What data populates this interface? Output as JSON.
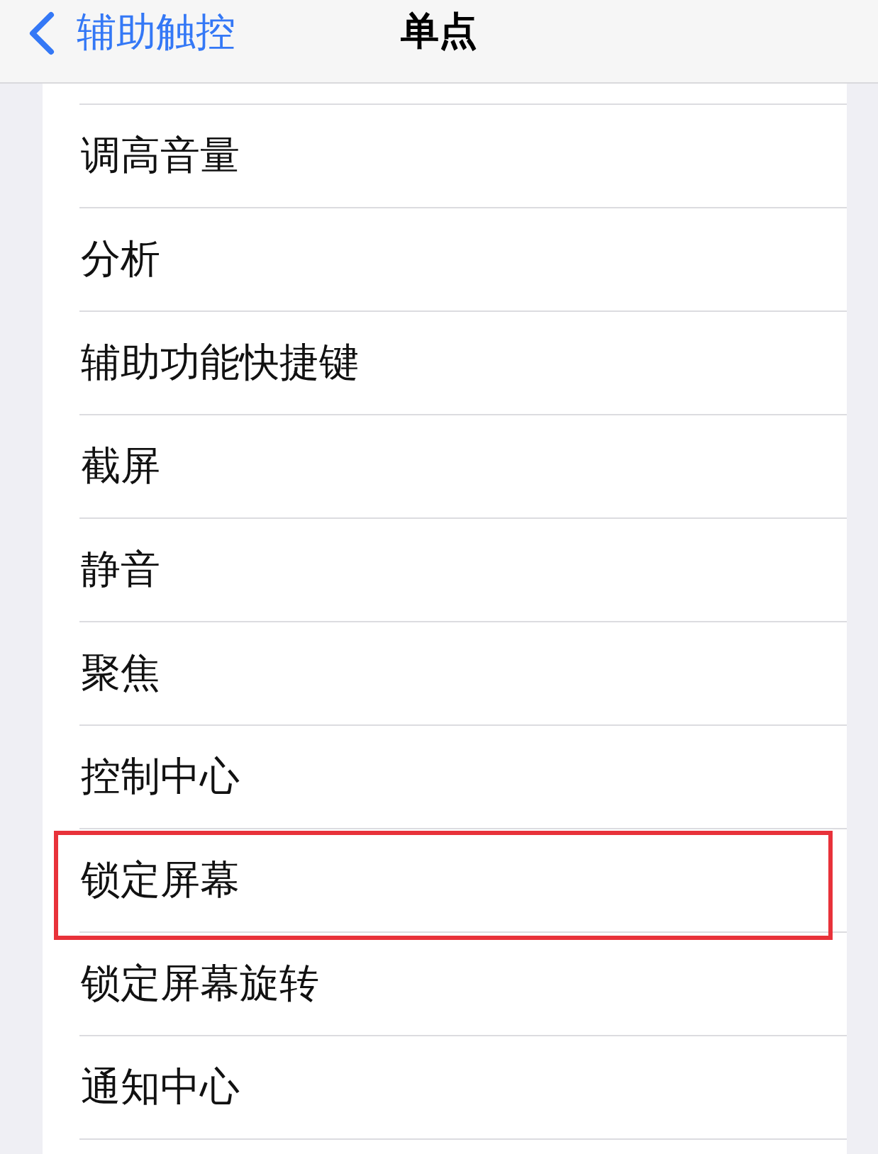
{
  "nav_bar": {
    "back_label": "辅助触控",
    "title": "单点"
  },
  "items": [
    {
      "label": "调高音量",
      "highlighted": false
    },
    {
      "label": "分析",
      "highlighted": false
    },
    {
      "label": "辅助功能快捷键",
      "highlighted": false
    },
    {
      "label": "截屏",
      "highlighted": false
    },
    {
      "label": "静音",
      "highlighted": false
    },
    {
      "label": "聚焦",
      "highlighted": false
    },
    {
      "label": "控制中心",
      "highlighted": false
    },
    {
      "label": "锁定屏幕",
      "highlighted": true
    },
    {
      "label": "锁定屏幕旋转",
      "highlighted": false
    },
    {
      "label": "通知中心",
      "highlighted": false
    }
  ]
}
